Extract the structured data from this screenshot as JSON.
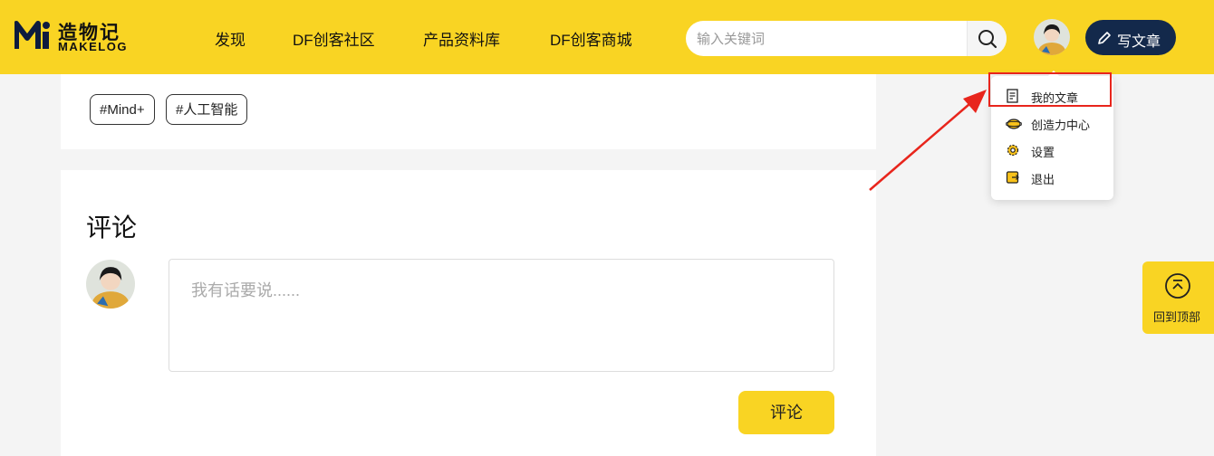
{
  "header": {
    "logo_cn": "造物记",
    "logo_en": "MAKELOG",
    "nav": [
      "发现",
      "DF创客社区",
      "产品资料库",
      "DF创客商城"
    ],
    "search_placeholder": "输入关键词",
    "write_label": "写文章"
  },
  "user_menu": {
    "items": [
      {
        "label": "我的文章",
        "icon": "article-icon"
      },
      {
        "label": "创造力中心",
        "icon": "creativity-icon"
      },
      {
        "label": "设置",
        "icon": "gear-icon"
      },
      {
        "label": "退出",
        "icon": "logout-icon"
      }
    ]
  },
  "article": {
    "tags": [
      "#Mind+",
      "#人工智能"
    ]
  },
  "comments": {
    "title": "评论",
    "placeholder": "我有话要说......",
    "submit_label": "评论"
  },
  "back_to_top_label": "回到顶部",
  "colors": {
    "brand_yellow": "#f9d423",
    "navy": "#13294b",
    "highlight_red": "#e8251c"
  }
}
